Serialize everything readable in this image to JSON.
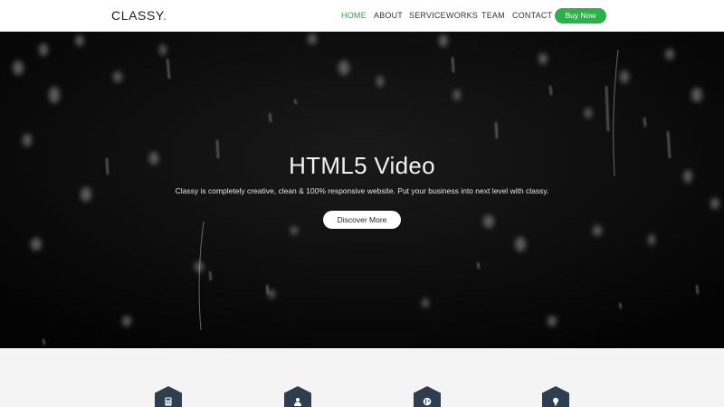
{
  "header": {
    "logo_text": "CLASSY",
    "logo_dot": ".",
    "nav": [
      {
        "label": "HOME",
        "active": true
      },
      {
        "label": "ABOUT",
        "active": false
      },
      {
        "label": "SERVICE",
        "active": false
      },
      {
        "label": "WORKS",
        "active": false
      },
      {
        "label": "TEAM",
        "active": false
      },
      {
        "label": "CONTACT",
        "active": false
      }
    ],
    "cta_label": "Buy Now"
  },
  "hero": {
    "title": "HTML5 Video",
    "subtitle": "Classy is completely creative, clean & 100% responsive website. Put your business into next level with classy.",
    "button_label": "Discover More"
  },
  "services": {
    "icons": [
      "calculator-icon",
      "user-icon",
      "globe-icon",
      "lightbulb-icon"
    ]
  },
  "colors": {
    "accent": "#2bb04a",
    "hero_bg": "#070707",
    "icon_hex": "#2c3e50"
  }
}
